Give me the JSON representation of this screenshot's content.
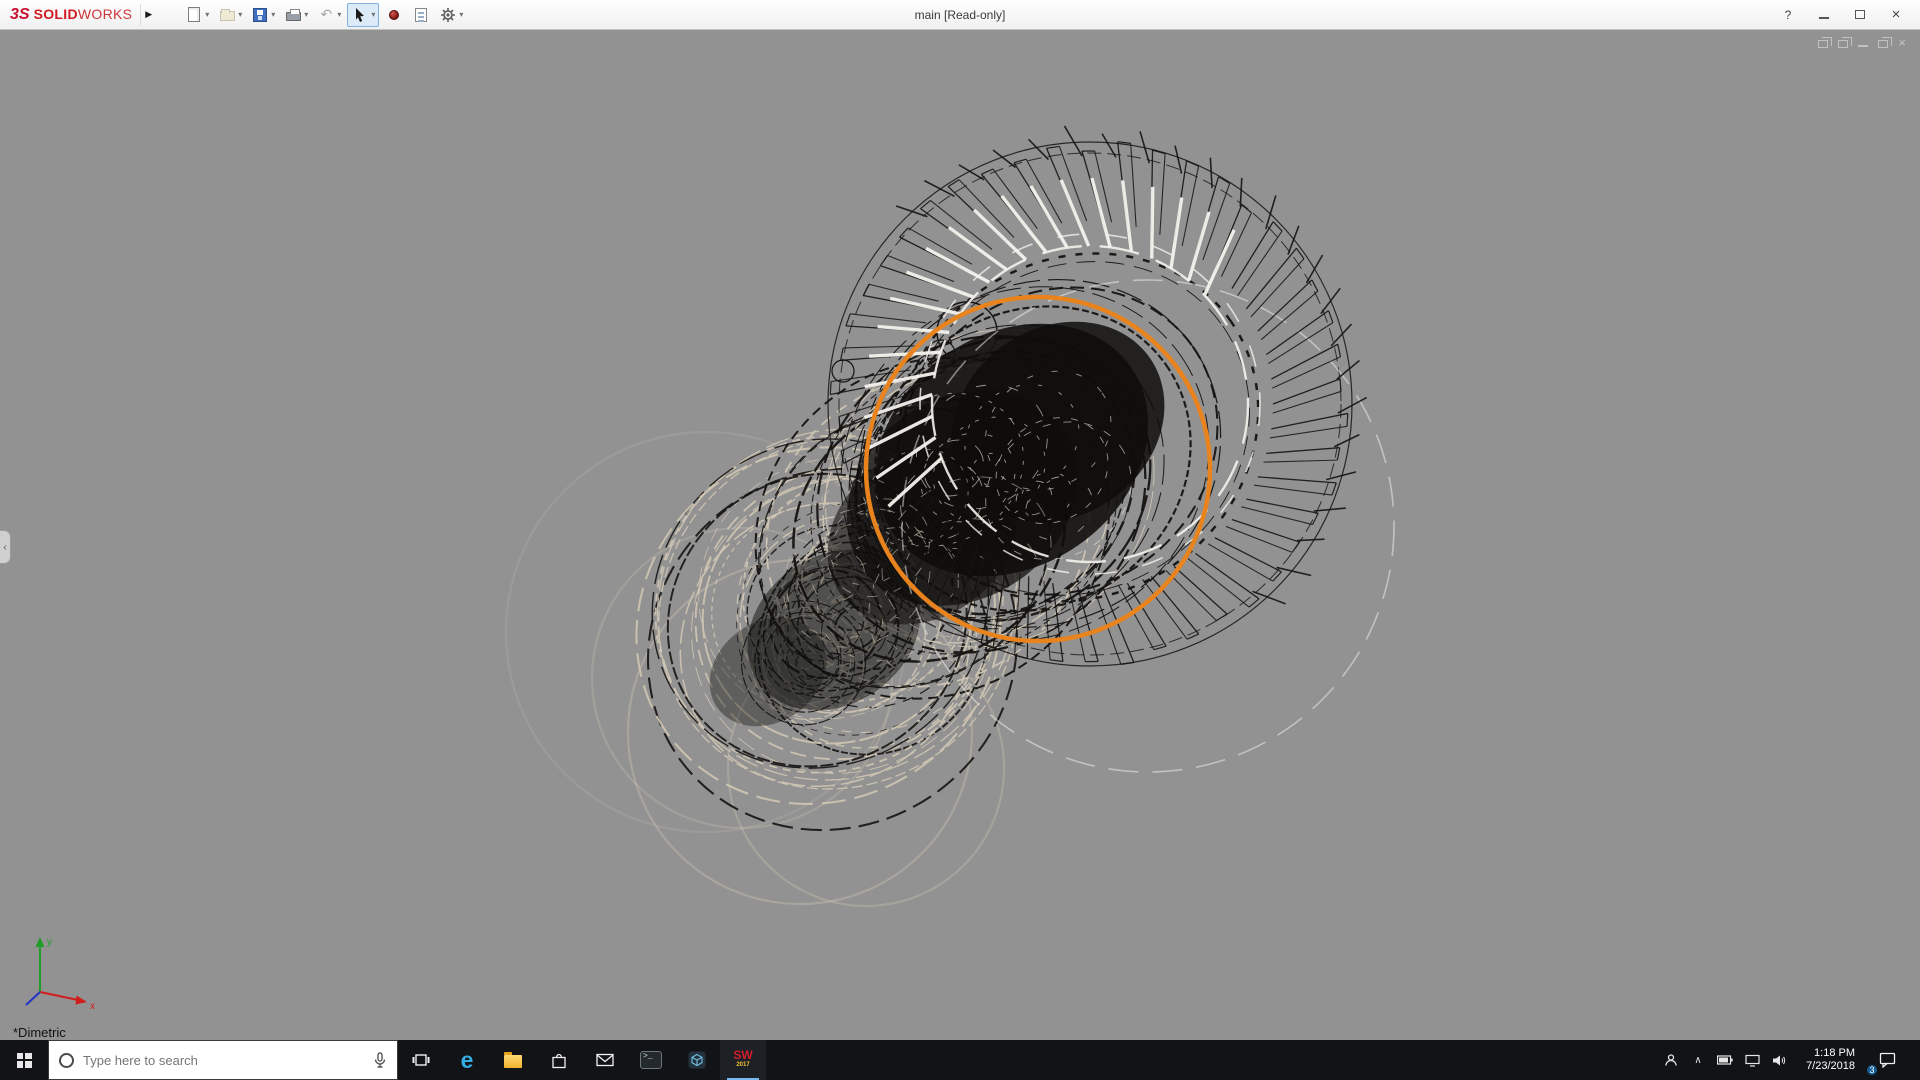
{
  "app": {
    "brand": {
      "logo_glyph": "3S",
      "name_bold": "SOLID",
      "name_light": "WORKS"
    },
    "title": "main [Read-only]"
  },
  "titlebar": {
    "menu_expand_glyph": "▶",
    "caret_glyph": "▾",
    "help_glyph": "?",
    "toolbar_icons": [
      "new-document",
      "open-document",
      "save",
      "print",
      "undo",
      "select-cursor",
      "rebuild",
      "file-properties",
      "options-gear"
    ]
  },
  "viewport": {
    "background": "#929292",
    "highlight_color": "#e8831d",
    "view_label": "*Dimetric",
    "panel_collapse_glyph": "‹",
    "axes": {
      "x_label": "x",
      "y_label": "y"
    }
  },
  "taskbar": {
    "search": {
      "placeholder": "Type here to search"
    },
    "edge_glyph": "e",
    "console_glyph": ">_",
    "solidworks": {
      "label": "SW",
      "year": "2017"
    },
    "tray": {
      "expand_glyph": "∧",
      "time": "1:18 PM",
      "date": "7/23/2018",
      "notification_count": "3"
    }
  }
}
